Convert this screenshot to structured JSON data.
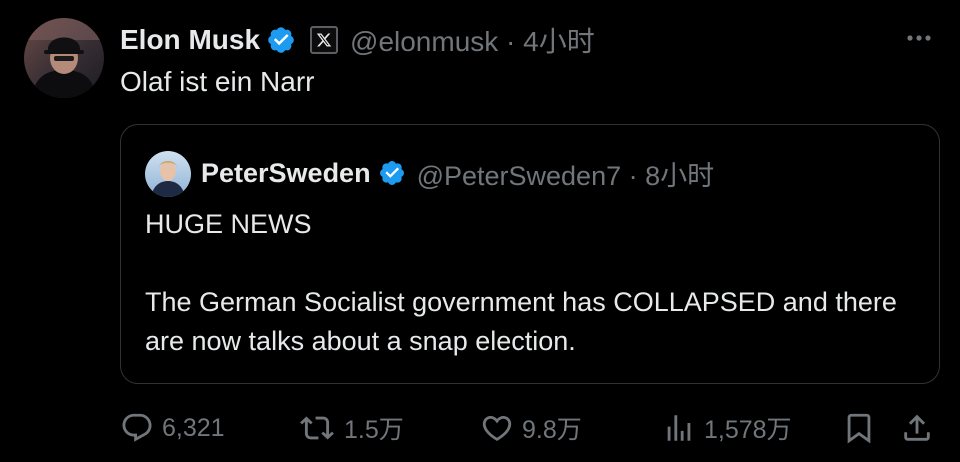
{
  "tweet": {
    "author": {
      "display_name": "Elon Musk",
      "handle_meta": "@elonmusk · 4小时",
      "verified": true,
      "avatar_icon": "profile-photo-icon",
      "affiliation_icon": "x-logo-icon"
    },
    "text": "Olaf ist ein Narr",
    "more_icon": "more-options-icon"
  },
  "quoted": {
    "author": {
      "display_name": "PeterSweden",
      "handle_meta": "@PeterSweden7 · 8小时",
      "verified": true,
      "avatar_icon": "profile-photo-icon"
    },
    "lines": {
      "headline": "HUGE NEWS",
      "body": "The German Socialist government has COLLAPSED and there are now talks about a snap election."
    }
  },
  "actions": {
    "replies": "6,321",
    "reposts": "1.5万",
    "likes": "9.8万",
    "views": "1,578万"
  },
  "colors": {
    "background": "#000000",
    "text_primary": "#e7e9ea",
    "text_secondary": "#71767b",
    "border": "#2f3336",
    "verified_blue": "#1d9bf0"
  }
}
